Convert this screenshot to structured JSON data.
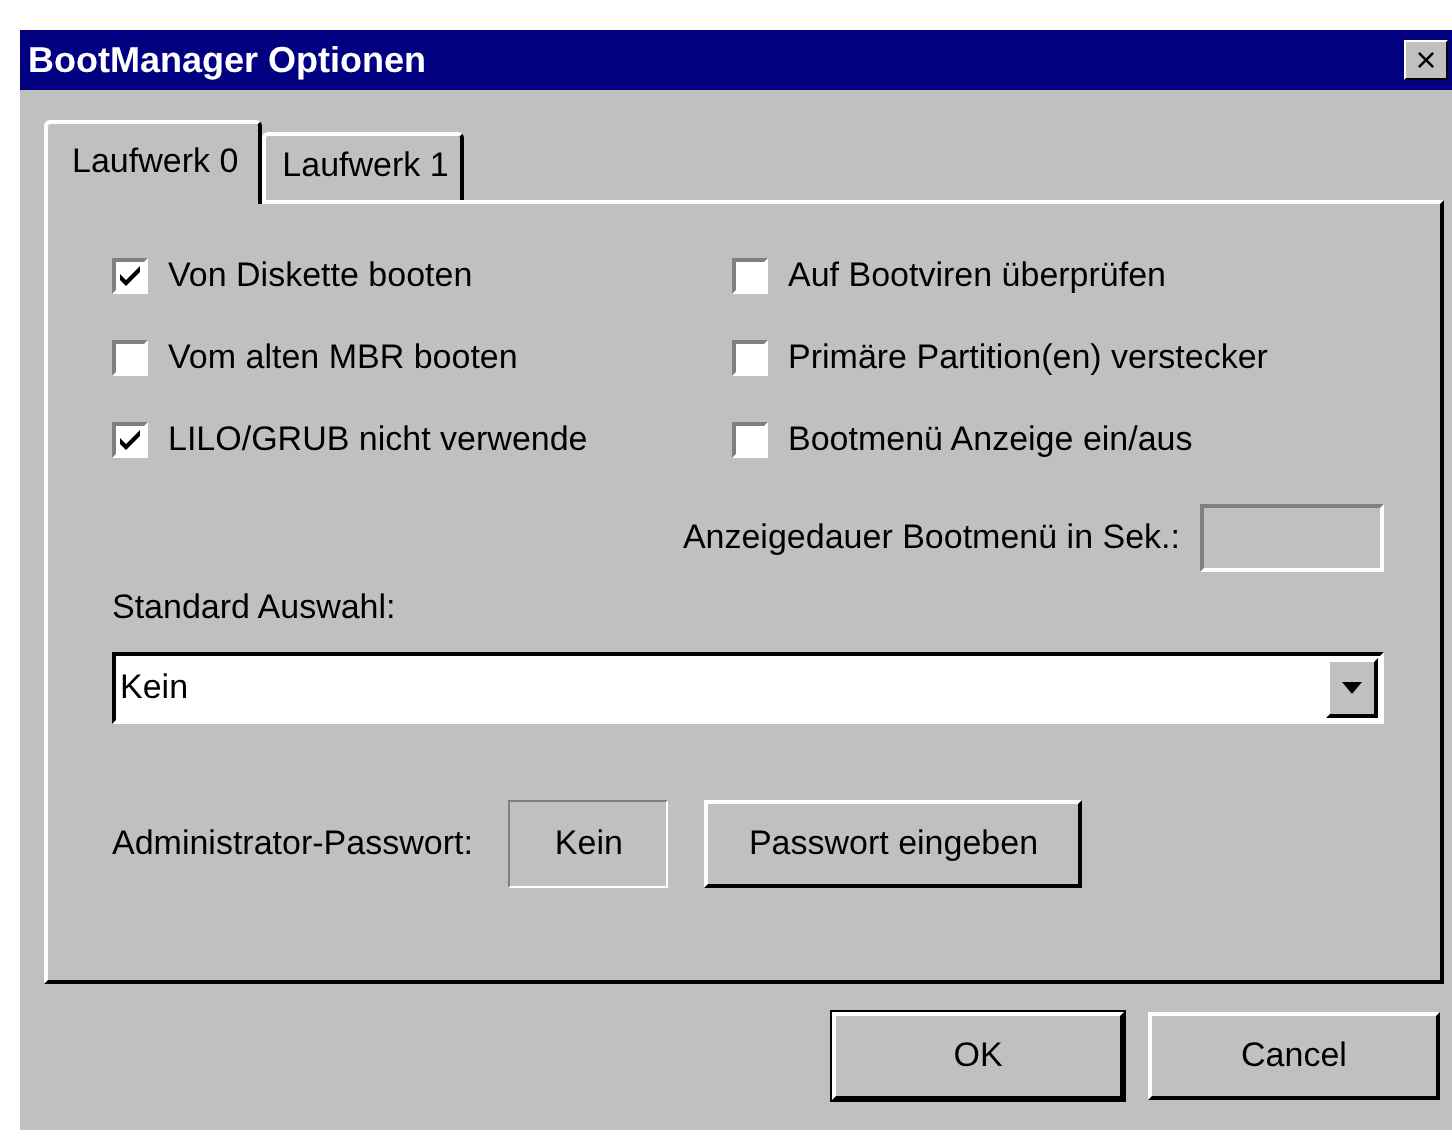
{
  "window": {
    "title": "BootManager Optionen",
    "close": "×"
  },
  "tabs": [
    {
      "label": "Laufwerk 0",
      "selected": true
    },
    {
      "label": "Laufwerk 1",
      "selected": false
    }
  ],
  "options": [
    {
      "label": "Von Diskette booten",
      "checked": true
    },
    {
      "label": "Auf Bootviren überprüfen",
      "checked": false
    },
    {
      "label": "Vom alten MBR booten",
      "checked": false
    },
    {
      "label": "Primäre Partition(en) verstecker",
      "checked": false
    },
    {
      "label": "LILO/GRUB nicht verwende",
      "checked": true
    },
    {
      "label": "Bootmenü Anzeige ein/aus",
      "checked": false
    }
  ],
  "timeout": {
    "label": "Anzeigedauer Bootmenü in Sek.:"
  },
  "default_selection": {
    "label": "Standard Auswahl:",
    "value": "Kein"
  },
  "admin_password": {
    "label": "Administrator-Passwort:",
    "value": "Kein",
    "button": "Passwort eingeben"
  },
  "buttons": [
    {
      "label": "OK",
      "default": true
    },
    {
      "label": "Cancel",
      "default": false
    }
  ]
}
